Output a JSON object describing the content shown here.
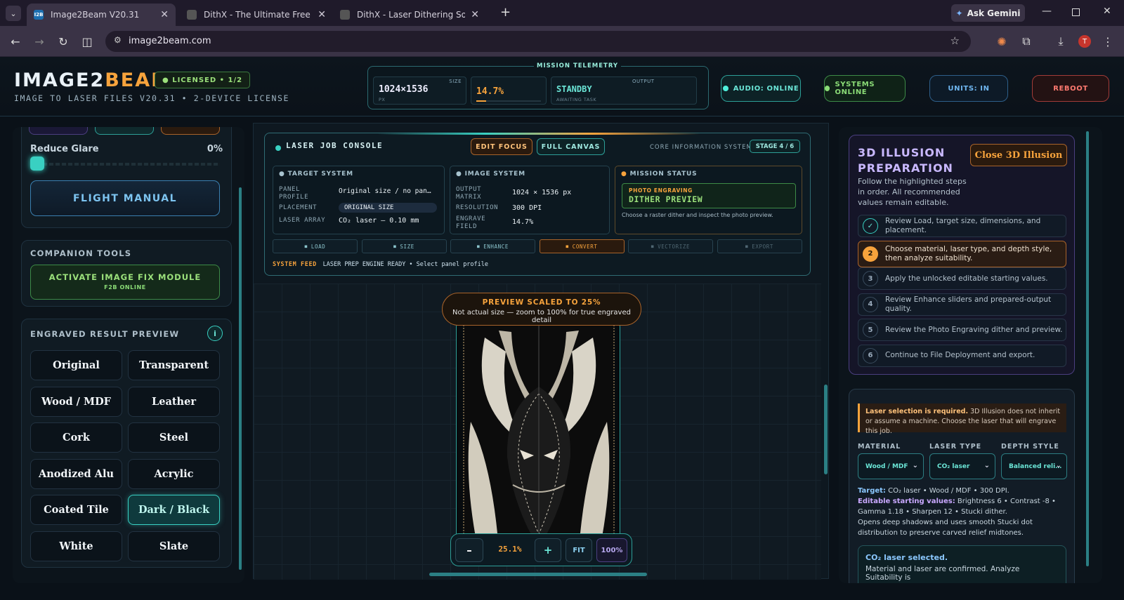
{
  "browser": {
    "tabs": [
      {
        "title": "Image2Beam V20.31",
        "favicon": "I2B"
      },
      {
        "title": "DithX - The Ultimate Free Laser"
      },
      {
        "title": "DithX - Laser Dithering Software"
      }
    ],
    "url": "image2beam.com",
    "gemini_label": "Ask Gemini",
    "profile_initial": "T"
  },
  "header": {
    "brand_a": "IMAGE2",
    "brand_b": "BEAM",
    "license_badge": "● LICENSED • 1/2",
    "subtitle": "IMAGE TO LASER FILES V20.31 • 2-DEVICE LICENSE",
    "telemetry": {
      "title": "MISSION TELEMETRY",
      "size_caption": "SIZE",
      "size_value": "1024×1536",
      "size_unit": "PX",
      "progress_value": "14.7%",
      "output_caption": "OUTPUT",
      "output_value": "STANDBY",
      "output_sub": "AWAITING TASK"
    },
    "audio": "AUDIO: ONLINE",
    "systems": "SYSTEMS ONLINE",
    "units": "UNITS: IN",
    "reboot": "REBOOT"
  },
  "left": {
    "reduce_glare_label": "Reduce Glare",
    "reduce_glare_value": "0%",
    "reduce_glare_level": 0,
    "flight_manual": "FLIGHT MANUAL",
    "companion_title": "COMPANION TOOLS",
    "activate_label": "ACTIVATE IMAGE FIX MODULE",
    "activate_sub": "F2B ONLINE",
    "preview_title": "ENGRAVED RESULT PREVIEW",
    "materials": [
      "Original",
      "Transparent",
      "Wood / MDF",
      "Leather",
      "Cork",
      "Steel",
      "Anodized Alu",
      "Acrylic",
      "Coated Tile",
      "Dark / Black",
      "White",
      "Slate"
    ],
    "selected_material": "Dark / Black"
  },
  "console": {
    "title": "LASER JOB CONSOLE",
    "edit_focus": "EDIT FOCUS",
    "full_canvas": "FULL CANVAS",
    "core_label": "CORE INFORMATION SYSTEM",
    "stage": "STAGE 4 / 6",
    "target": {
      "heading": "TARGET SYSTEM",
      "panel_profile_k": "PANEL PROFILE",
      "panel_profile_v": "Original size / no pan…",
      "placement_k": "PLACEMENT",
      "placement_v": "ORIGINAL SIZE",
      "laser_array_k": "LASER ARRAY",
      "laser_array_v": "CO₂ laser — 0.10 mm"
    },
    "image": {
      "heading": "IMAGE SYSTEM",
      "output_k": "OUTPUT MATRIX",
      "output_v": "1024 × 1536 px",
      "resolution_k": "RESOLUTION",
      "resolution_v": "300 DPI",
      "engrave_k": "ENGRAVE FIELD",
      "engrave_v": "14.7%"
    },
    "mission": {
      "heading": "MISSION STATUS",
      "tag": "PHOTO ENGRAVING",
      "main": "DITHER PREVIEW",
      "note": "Choose a raster dither and inspect the photo preview."
    },
    "stages": [
      "LOAD",
      "SIZE",
      "ENHANCE",
      "CONVERT",
      "VECTORIZE",
      "EXPORT"
    ],
    "feed_label": "SYSTEM FEED",
    "feed_text": "LASER PREP ENGINE READY • Select panel profile"
  },
  "preview": {
    "scaled_title": "PREVIEW SCALED TO 25%",
    "scaled_note": "Not actual size — zoom to 100% for true engraved detail",
    "zoom_value": "25.1%",
    "minus": "–",
    "plus": "+",
    "fit": "FIT",
    "hundred": "100%"
  },
  "right": {
    "title_line1": "3D ILLUSION",
    "title_line2": "PREPARATION",
    "close_btn": "Close 3D Illusion",
    "intro": "Follow the highlighted steps in order. All recommended values remain editable.",
    "steps": [
      {
        "n": "✓",
        "text": "Review Load, target size, dimensions, and placement."
      },
      {
        "n": "2",
        "text": "Choose material, laser type, and depth style, then analyze suitability."
      },
      {
        "n": "3",
        "text": "Apply the unlocked editable starting values."
      },
      {
        "n": "4",
        "text": "Review Enhance sliders and prepared-output quality."
      },
      {
        "n": "5",
        "text": "Review the Photo Engraving dither and preview."
      },
      {
        "n": "6",
        "text": "Continue to File Deployment and export."
      }
    ],
    "warn_bold": "Laser selection is required.",
    "warn_text": " 3D Illusion does not inherit or assume a machine. Choose the laser that will engrave this job.",
    "material_h": "MATERIAL",
    "laser_h": "LASER TYPE",
    "depth_h": "DEPTH STYLE",
    "material_v": "Wood / MDF",
    "laser_v": "CO₂ laser",
    "depth_v": "Balanced reli…",
    "target_b": "Target:",
    "target_t": " CO₂ laser • Wood / MDF • 300 DPI.",
    "editable_b": "Editable starting values:",
    "editable_t": " Brightness 6 • Contrast -8 • Gamma 1.18 • Sharpen 12 • Stucki dither.",
    "opens_t": "Opens deep shadows and uses smooth Stucki dot distribution to preserve carved relief midtones.",
    "co2_title": "CO₂ laser selected.",
    "co2_text": "Material and laser are confirmed. Analyze Suitability is"
  },
  "colors": {
    "accent": "#39d0c2",
    "orange": "#f7a33c",
    "green": "#8bdc77",
    "danger": "#ff6b5e"
  }
}
